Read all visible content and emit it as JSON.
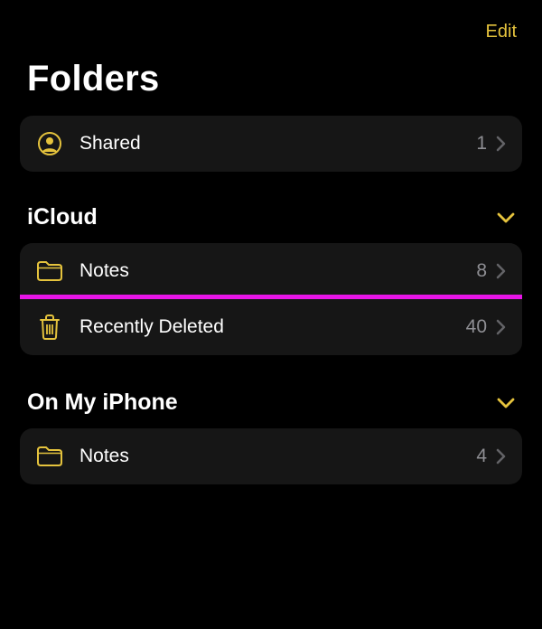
{
  "colors": {
    "accent": "#e5c33d",
    "highlight": "#e815e8",
    "secondary": "#8e8e93"
  },
  "topbar": {
    "edit_label": "Edit"
  },
  "title": "Folders",
  "shared_section": {
    "items": [
      {
        "icon": "person-circle",
        "label": "Shared",
        "count": "1"
      }
    ]
  },
  "sections": [
    {
      "title": "iCloud",
      "expanded": true,
      "items": [
        {
          "icon": "folder",
          "label": "Notes",
          "count": "8",
          "highlighted": false
        },
        {
          "icon": "trash",
          "label": "Recently Deleted",
          "count": "40",
          "highlighted": true
        }
      ]
    },
    {
      "title": "On My iPhone",
      "expanded": true,
      "items": [
        {
          "icon": "folder",
          "label": "Notes",
          "count": "4",
          "highlighted": false
        }
      ]
    }
  ]
}
